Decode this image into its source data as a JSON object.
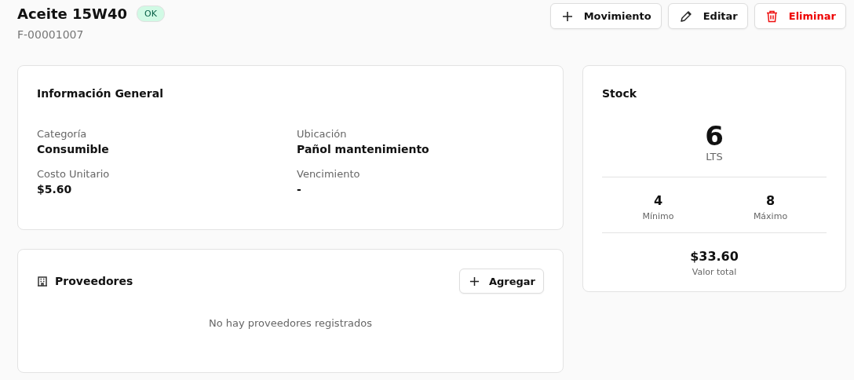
{
  "header": {
    "title": "Aceite 15W40",
    "status": {
      "label": "OK",
      "color": "#d1fae5"
    },
    "code": "F-00001007",
    "actions": [
      {
        "label": "Movimiento",
        "kind": "plus"
      },
      {
        "label": "Editar",
        "kind": "edit"
      },
      {
        "label": "Eliminar",
        "kind": "delete"
      }
    ]
  },
  "general": {
    "title": "Información General",
    "fields": [
      {
        "label": "Categoría",
        "value": "Consumible"
      },
      {
        "label": "Ubicación",
        "value": "Pañol mantenimiento"
      },
      {
        "label": "Costo Unitario",
        "value": "$5.60"
      },
      {
        "label": "Vencimiento",
        "value": "-"
      }
    ]
  },
  "suppliers": {
    "title": "Proveedores",
    "add_button": "Agregar",
    "empty": "No hay proveedores registrados"
  },
  "stock": {
    "title": "Stock",
    "quantity": "6",
    "unit": "LTS",
    "min": {
      "value": "4",
      "label": "Mínimo"
    },
    "max": {
      "value": "8",
      "label": "Máximo"
    },
    "total": {
      "value": "$33.60",
      "label": "Valor total"
    }
  }
}
